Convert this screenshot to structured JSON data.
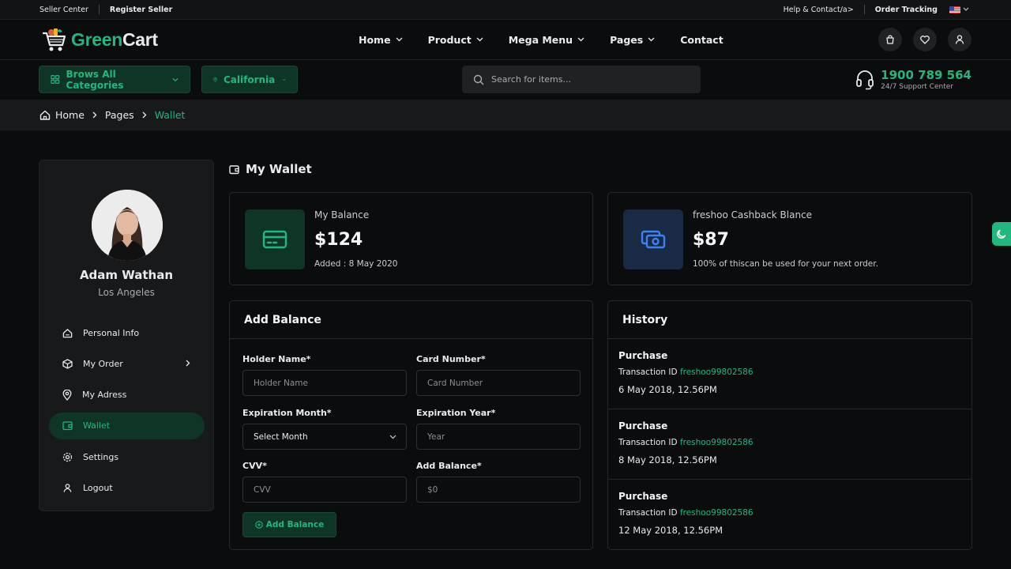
{
  "topbar": {
    "seller_center": "Seller Center",
    "register_seller": "Register Seller",
    "help": "Help & Contact/a>",
    "order_tracking": "Order Tracking"
  },
  "header": {
    "logo_green": "Green",
    "logo_cart": "Cart",
    "nav": [
      "Home",
      "Product",
      "Mega Menu",
      "Pages",
      "Contact"
    ]
  },
  "subheader": {
    "categories": "Brows All Categories",
    "location": "California",
    "search_placeholder": "Search for items...",
    "phone": "1900 789 564",
    "support": "24/7 Support Center"
  },
  "breadcrumb": [
    "Home",
    "Pages",
    "Wallet"
  ],
  "profile": {
    "name": "Adam Wathan",
    "location": "Los Angeles",
    "menu": [
      "Personal Info",
      "My Order",
      "My Adress",
      "Wallet",
      "Settings",
      "Logout"
    ],
    "active": "Wallet"
  },
  "wallet": {
    "title": "My Wallet",
    "balance": {
      "label": "My Balance",
      "amount": "$124",
      "note": "Added : 8 May 2020"
    },
    "cashback": {
      "label": "freshoo Cashback Blance",
      "amount": "$87",
      "note": "100% of thiscan be used for your next order."
    }
  },
  "add_balance": {
    "title": "Add Balance",
    "holder_label": "Holder Name*",
    "holder_placeholder": "Holder Name",
    "card_label": "Card Number*",
    "card_placeholder": "Card Number",
    "month_label": "Expiration Month*",
    "month_value": "Select Month",
    "year_label": "Expiration Year*",
    "year_placeholder": "Year",
    "cvv_label": "CVV*",
    "cvv_placeholder": "CVV",
    "amount_label": "Add Balance*",
    "amount_placeholder": "$0",
    "button": "Add Balance"
  },
  "history": {
    "title": "History",
    "tx_prefix": "Transaction ID",
    "items": [
      {
        "type": "Purchase",
        "id": "freshoo99802586",
        "date": "6 May 2018, 12.56PM"
      },
      {
        "type": "Purchase",
        "id": "freshoo99802586",
        "date": "8 May 2018, 12.56PM"
      },
      {
        "type": "Purchase",
        "id": "freshoo99802586",
        "date": "12 May 2018, 12.56PM"
      }
    ]
  },
  "colors": {
    "accent": "#21b77e",
    "accent_bg": "#0f3527",
    "cashback_icon": "#3b82f6",
    "cashback_bg": "#1a2a45"
  }
}
